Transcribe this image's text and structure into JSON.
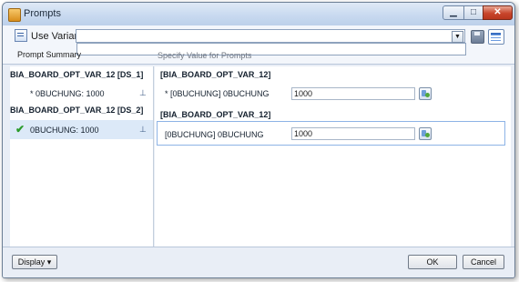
{
  "window": {
    "title": "Prompts",
    "minimize_glyph": "▁",
    "maximize_glyph": "□",
    "close_glyph": "✕"
  },
  "toolbar": {
    "use_variant_label": "Use Variant",
    "variant_value": "",
    "dropdown_glyph": "▼",
    "prompt_summary_label": "Prompt Summary",
    "specify_value_label": "Specify Value for Prompts",
    "summary_value": ""
  },
  "summary_groups": [
    {
      "title": "BIA_BOARD_OPT_VAR_12 [DS_1]",
      "item": "* 0BUCHUNG: 1000",
      "pin_glyph": "⊥"
    },
    {
      "title": "BIA_BOARD_OPT_VAR_12 [DS_2]",
      "item": "0BUCHUNG: 1000",
      "pin_glyph": "⊥",
      "check_glyph": "✔"
    }
  ],
  "params": [
    {
      "title": "[BIA_BOARD_OPT_VAR_12]",
      "label": "* [0BUCHUNG] 0BUCHUNG",
      "value": "1000"
    },
    {
      "title": "[BIA_BOARD_OPT_VAR_12]",
      "label": "[0BUCHUNG] 0BUCHUNG",
      "value": "1000"
    }
  ],
  "footer": {
    "display_label": "Display",
    "display_arrow": "▾",
    "ok_label": "OK",
    "cancel_label": "Cancel"
  },
  "colors": {
    "accent": "#3a6fc2",
    "selected_row": "#dce9f8",
    "check": "#2b9b2b"
  }
}
